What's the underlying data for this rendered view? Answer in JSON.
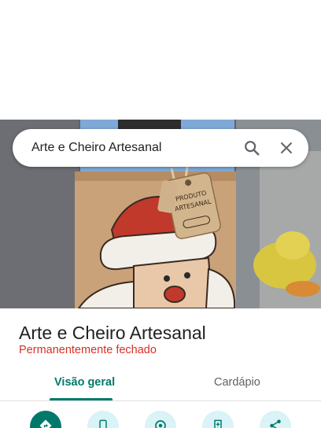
{
  "search": {
    "query": "Arte e Cheiro Artesanal",
    "search_icon": "search-icon",
    "close_icon": "close-icon"
  },
  "photo": {
    "tag_line1": "PRODUTO",
    "tag_line2": "ARTESANAL"
  },
  "place": {
    "name": "Arte e Cheiro Artesanal",
    "status": "Permanentemente fechado",
    "status_color": "#d93025"
  },
  "tabs": [
    {
      "label": "Visão geral",
      "active": true
    },
    {
      "label": "Cardápio",
      "active": false
    }
  ],
  "actions": [
    {
      "icon": "directions-icon"
    },
    {
      "icon": "phone-icon"
    },
    {
      "icon": "nearby-icon"
    },
    {
      "icon": "save-icon"
    },
    {
      "icon": "share-icon"
    }
  ],
  "colors": {
    "accent": "#00796b",
    "action_bg": "#d9f3f7",
    "text": "#202124"
  }
}
